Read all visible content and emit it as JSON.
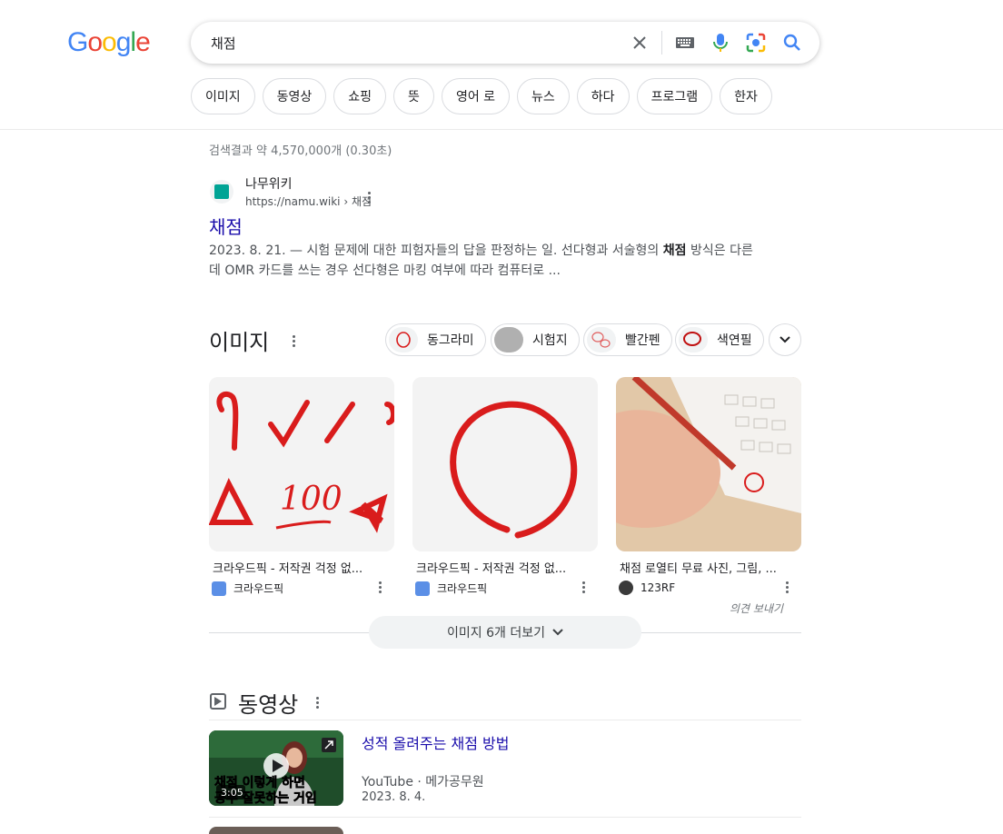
{
  "logo": {
    "letters": [
      "G",
      "o",
      "o",
      "g",
      "l",
      "e"
    ]
  },
  "search": {
    "query": "채점"
  },
  "filter_chips": [
    "이미지",
    "동영상",
    "쇼핑",
    "뜻",
    "영어 로",
    "뉴스",
    "하다",
    "프로그램",
    "한자"
  ],
  "stats": "검색결과 약 4,570,000개 (0.30초)",
  "result": {
    "site_name": "나무위키",
    "url": "https://namu.wiki › 채점",
    "title": "채점",
    "snippet_1": "2023. 8. 21. — 시험 문제에 대한 피험자들의 답을 판정하는 일. 선다형과 서술형의 ",
    "snippet_bold": "채점",
    "snippet_2": " 방식은 다른데 OMR 카드를 쓰는 경우 선다형은 마킹 여부에 따라 컴퓨터로 ..."
  },
  "images": {
    "title": "이미지",
    "chips": [
      "동그라미",
      "시험지",
      "빨간펜",
      "색연필"
    ],
    "cards": [
      {
        "caption": "크라우드픽 - 저작권 걱정 없...",
        "source": "크라우드픽"
      },
      {
        "caption": "크라우드픽 - 저작권 걱정 없...",
        "source": "크라우드픽"
      },
      {
        "caption": "채점 로열티 무료 사진, 그림, ...",
        "source": "123RF"
      }
    ],
    "card1_text": "100",
    "feedback": "의견 보내기",
    "more_button": "이미지 6개 더보기"
  },
  "videos": {
    "title": "동영상",
    "items": [
      {
        "title": "성적 올려주는 채점 방법",
        "source": "YouTube · 메가공무원",
        "date": "2023. 8. 4.",
        "duration": "3:05",
        "overlay_line1": "채점 이렇게 하면",
        "overlay_line2": "공부 잘못하는 거임"
      }
    ]
  },
  "colors": {
    "link": "#1a0dab",
    "accent_red": "#d91c1c"
  }
}
